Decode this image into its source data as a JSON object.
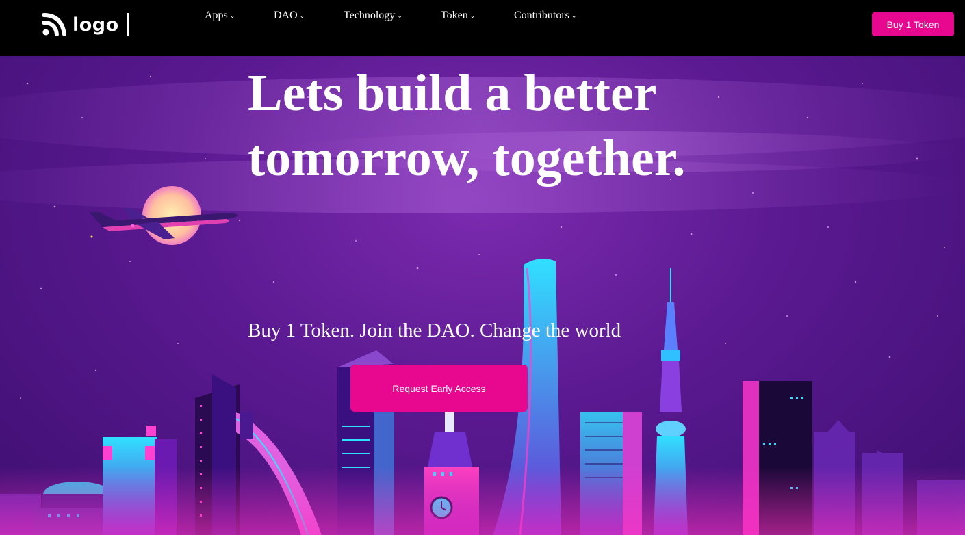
{
  "nav": {
    "logo_text": "logo",
    "menu": [
      {
        "label": "Apps"
      },
      {
        "label": "DAO"
      },
      {
        "label": "Technology"
      },
      {
        "label": "Token"
      },
      {
        "label": "Contributors"
      }
    ],
    "buy_label": "Buy 1 Token"
  },
  "hero": {
    "headline_line1": "Lets build a better",
    "headline_line2": "tomorrow, together.",
    "subline": "Buy 1 Token. Join the DAO. Change the world",
    "cta_label": "Request Early Access"
  },
  "colors": {
    "accent": "#e8088f",
    "nav_bg": "#000000",
    "sky": "#5a1990"
  }
}
